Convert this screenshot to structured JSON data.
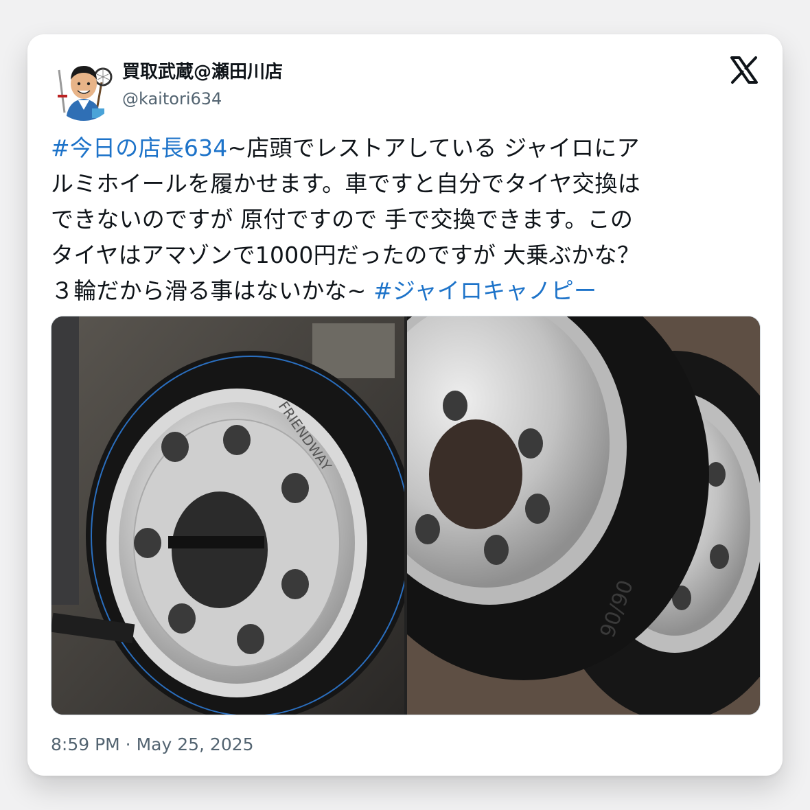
{
  "author": {
    "display_name": "買取武蔵@瀬田川店",
    "handle": "@kaitori634",
    "avatar_label": "kaitori634-avatar"
  },
  "platform_icon": "x-logo-icon",
  "tweet": {
    "lines": [
      [
        {
          "text": "#今日の店長634",
          "tag": true
        },
        {
          "text": "~店頭でレストアしている ジャイロにア",
          "tag": false
        }
      ],
      [
        {
          "text": "ルミホイールを履かせます。車ですと自分でタイヤ交換は",
          "tag": false
        }
      ],
      [
        {
          "text": "できないのですが 原付ですので 手で交換できます。この",
          "tag": false
        }
      ],
      [
        {
          "text": "タイヤはアマゾンで1000円だったのですが 大乗ぶかな？",
          "tag": false
        }
      ],
      [
        {
          "text": "３輪だから滑る事はないかな~ ",
          "tag": false
        },
        {
          "text": "#ジャイロキャノピー",
          "tag": true
        }
      ]
    ]
  },
  "media": {
    "left_photo": {
      "tire_brand": "FRIENDWAY"
    },
    "right_photo": {
      "tire_size": "90/90"
    }
  },
  "timestamp": "8:59 PM · May 25, 2025",
  "colors": {
    "hashtag": "#1d73c9",
    "text": "#0f1419",
    "muted": "#536471"
  }
}
